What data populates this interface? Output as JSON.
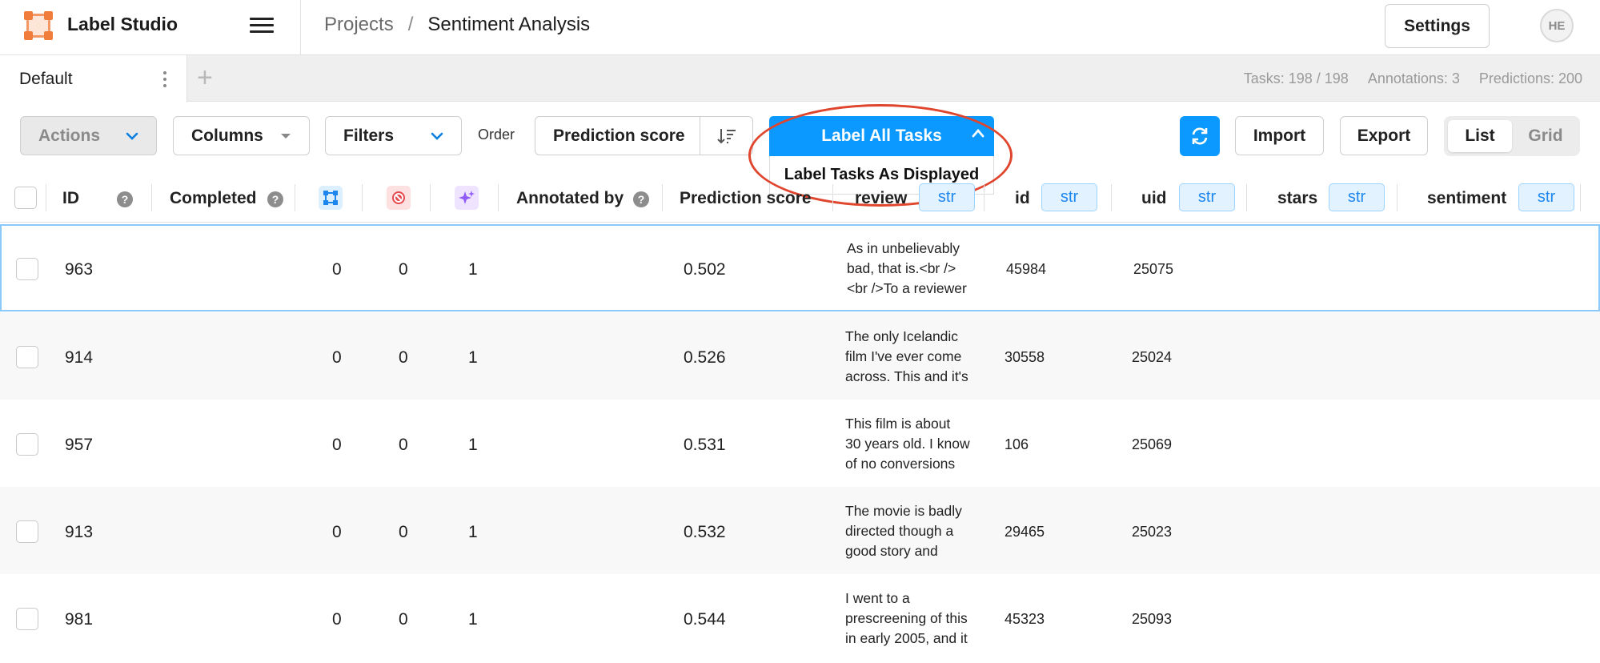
{
  "app": {
    "title": "Label Studio"
  },
  "breadcrumb": {
    "projects": "Projects",
    "separator": "/",
    "project": "Sentiment Analysis"
  },
  "header": {
    "settings_label": "Settings",
    "avatar_initials": "HE"
  },
  "tabs": [
    {
      "label": "Default"
    }
  ],
  "tab_add": "+",
  "stats": {
    "tasks": "Tasks: 198 / 198",
    "annotations": "Annotations: 3",
    "predictions": "Predictions: 200"
  },
  "toolbar": {
    "actions": "Actions",
    "columns": "Columns",
    "filters": "Filters",
    "order_label": "Order",
    "order_value": "Prediction score",
    "label_all": "Label All Tasks",
    "label_displayed": "Label Tasks As Displayed",
    "import": "Import",
    "export": "Export",
    "view_list": "List",
    "view_grid": "Grid"
  },
  "colors": {
    "accent": "#0b99ff",
    "highlight": "#e0452e",
    "tag_bg": "#e2f3ff",
    "tag_text": "#1c86ee"
  },
  "columns": {
    "id": "ID",
    "completed": "Completed",
    "annotated_by": "Annotated by",
    "prediction_score": "Prediction score",
    "review": "review",
    "id2": "id",
    "uid": "uid",
    "stars": "stars",
    "sentiment": "sentiment",
    "type_tag": "str",
    "help": "?",
    "icons": [
      "annotations-icon",
      "cancelled-icon",
      "predictions-icon"
    ]
  },
  "rows": [
    {
      "id": "963",
      "total": "0",
      "cancelled": "0",
      "predictions": "1",
      "score": "0.502",
      "review": [
        "As in unbelievably",
        "bad, that is.<br />",
        "<br />To a reviewer"
      ],
      "rid": "45984",
      "uid": "25075"
    },
    {
      "id": "914",
      "total": "0",
      "cancelled": "0",
      "predictions": "1",
      "score": "0.526",
      "review": [
        "The only Icelandic",
        "film I've ever come",
        "across. This and it's"
      ],
      "rid": "30558",
      "uid": "25024"
    },
    {
      "id": "957",
      "total": "0",
      "cancelled": "0",
      "predictions": "1",
      "score": "0.531",
      "review": [
        "This film is about",
        "30 years old. I know",
        "of no conversions"
      ],
      "rid": "106",
      "uid": "25069"
    },
    {
      "id": "913",
      "total": "0",
      "cancelled": "0",
      "predictions": "1",
      "score": "0.532",
      "review": [
        "The movie is badly",
        "directed though a",
        "good story and"
      ],
      "rid": "29465",
      "uid": "25023"
    },
    {
      "id": "981",
      "total": "0",
      "cancelled": "0",
      "predictions": "1",
      "score": "0.544",
      "review": [
        "I went to a",
        "prescreening of this",
        "in early 2005, and it"
      ],
      "rid": "45323",
      "uid": "25093"
    }
  ]
}
